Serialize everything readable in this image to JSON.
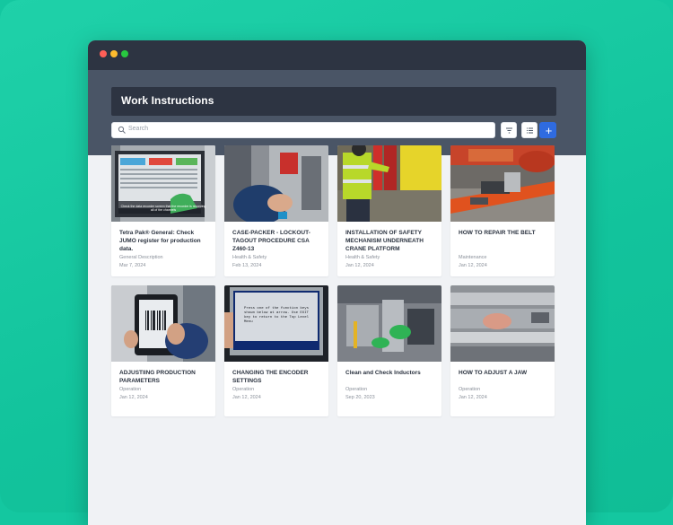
{
  "app": {
    "title": "Work Instructions"
  },
  "search": {
    "placeholder": "Search"
  },
  "toolbar": {
    "add_label": "+"
  },
  "colors": {
    "accent": "#2f6be0",
    "header": "#2d3442",
    "background": "#14c7a0"
  },
  "cards": [
    {
      "title": "Tetra Pak® General: Check JUMO register for production data.",
      "category": "General Description",
      "date": "Mar 7, 2024",
      "thumb_caption": "Check the data recorder screen that the recorder is recording all of the channels"
    },
    {
      "title": "CASE-PACKER - LOCKOUT-TAGOUT PROCEDURE CSA Z460-13",
      "category": "Health & Safety",
      "date": "Feb 13, 2024"
    },
    {
      "title": "INSTALLATION OF SAFETY MECHANISM UNDERNEATH CRANE PLATFORM",
      "category": "Health & Safety",
      "date": "Jan 12, 2024"
    },
    {
      "title": "HOW TO REPAIR THE BELT",
      "category": "Maintenance",
      "date": "Jan 12, 2024"
    },
    {
      "title": "ADJUSTIING PRODUCTION PARAMETERS",
      "category": "Operation",
      "date": "Jan 12, 2024"
    },
    {
      "title": "CHANGING THE ENCODER SETTINGS",
      "category": "Operation",
      "date": "Jan 12, 2024",
      "thumb_caption": "Press one of the function keys shown below at arrow. Use EXIT key to return to the Top Level Menu"
    },
    {
      "title": "Clean and Check Inductors",
      "category": "Operation",
      "date": "Sep 20, 2023"
    },
    {
      "title": "HOW TO ADJUST A JAW",
      "category": "Operation",
      "date": "Jan 12, 2024"
    }
  ]
}
